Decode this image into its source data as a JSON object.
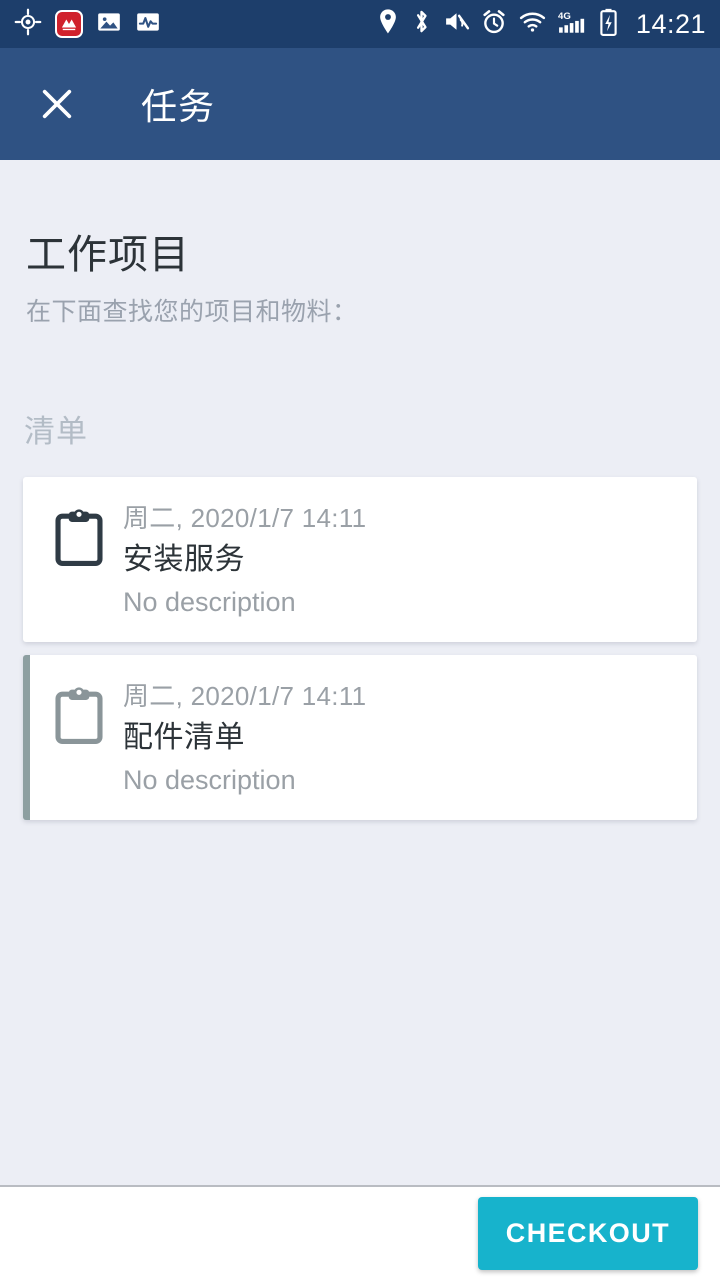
{
  "status_bar": {
    "time": "14:21",
    "left_icons": [
      {
        "name": "gps-location-icon"
      },
      {
        "name": "app-logo-icon"
      },
      {
        "name": "gallery-photo-icon"
      },
      {
        "name": "activity-pulse-icon"
      }
    ],
    "right_icons": [
      {
        "name": "location-pin-icon"
      },
      {
        "name": "bluetooth-icon"
      },
      {
        "name": "volume-mute-icon"
      },
      {
        "name": "alarm-clock-icon"
      },
      {
        "name": "wifi-icon"
      },
      {
        "name": "signal-4g-icon",
        "label": "4G"
      },
      {
        "name": "battery-charging-icon"
      }
    ],
    "background_color": "#1d3e6b"
  },
  "app_bar": {
    "close_label": "×",
    "title": "任务",
    "background_color": "#2f5283"
  },
  "main": {
    "page_title": "工作项目",
    "page_subtitle": "在下面查找您的项目和物料：",
    "section_label": "清单",
    "background_color": "#eceef5",
    "cards": [
      {
        "icon": "clipboard-icon",
        "date": "周二, 2020/1/7 14:11",
        "title": "安装服务",
        "description": "No description",
        "accent": false,
        "icon_color": "#2f3b45"
      },
      {
        "icon": "clipboard-icon",
        "date": "周二, 2020/1/7 14:11",
        "title": "配件清单",
        "description": "No description",
        "accent": true,
        "accent_color": "#8d9fa1",
        "icon_color": "#8a9599"
      }
    ]
  },
  "bottom_bar": {
    "checkout_label": "CHECKOUT",
    "checkout_color": "#17b3cc"
  }
}
